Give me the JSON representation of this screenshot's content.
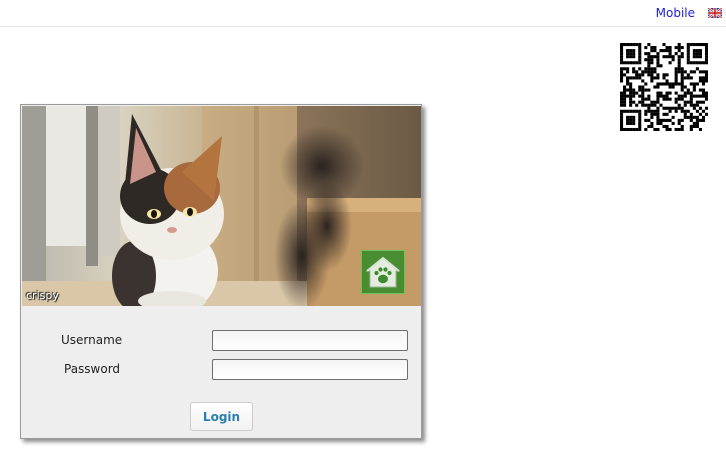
{
  "header": {
    "mobile_label": "Mobile"
  },
  "login": {
    "photo_caption": "crispy",
    "username_label": "Username",
    "password_label": "Password",
    "username_value": "",
    "password_value": "",
    "button_label": "Login"
  },
  "colors": {
    "link": "#2222cc",
    "button_text": "#2a7fb0",
    "panel_bg": "#eeeeee",
    "home_icon_bg": "#3c8c2e"
  },
  "icons": [
    "uk-flag-icon",
    "qr-code-icon",
    "home-paw-icon"
  ]
}
